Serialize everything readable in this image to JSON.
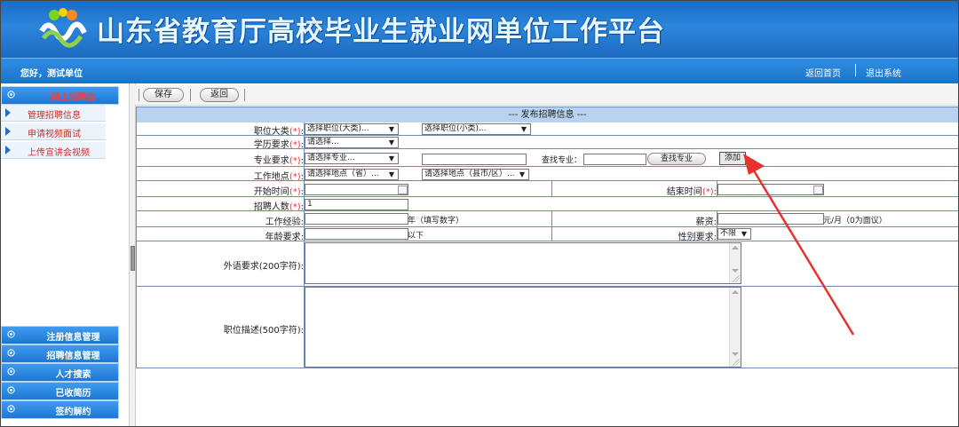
{
  "header": {
    "title": "山东省教育厅高校毕业生就业网单位工作平台",
    "greeting": "您好，测试单位",
    "home_link": "返回首页",
    "logout_link": "退出系统"
  },
  "sidebar": {
    "top_menu": "网上招聘会",
    "sub_items": [
      "管理招聘信息",
      "申请视频面试",
      "上传宣讲会视频"
    ],
    "bottom_menus": [
      "注册信息管理",
      "招聘信息管理",
      "人才搜索",
      "已收简历",
      "签约解约"
    ]
  },
  "toolbar": {
    "save_label": "保存",
    "back_label": "返回"
  },
  "form": {
    "title": "--- 发布招聘信息 ---",
    "required_mark": "(*)",
    "position_category_label": "职位大类",
    "position_category_select": "选择职位(大类)...",
    "position_sub_select": "选择职位(小类)...",
    "education_label": "学历要求",
    "education_select": "请选择...",
    "major_label": "专业要求",
    "major_select": "请选择专业...",
    "find_major_label": "查找专业：",
    "find_major_button": "查找专业",
    "add_button": "添加",
    "location_label": "工作地点",
    "province_select": "请选择地点（省）...",
    "city_select": "请选择地点（县市/区）...",
    "start_time_label": "开始时间",
    "end_time_label": "结束时间",
    "headcount_label": "招聘人数",
    "headcount_value": "1",
    "experience_label": "工作经验:",
    "experience_suffix": "年（填写数字）",
    "salary_label": "薪资:",
    "salary_suffix": "元/月（0为面议）",
    "age_label": "年龄要求:",
    "age_suffix": "以下",
    "gender_label": "性别要求:",
    "gender_select": "不限",
    "language_label": "外语要求(200字符):",
    "description_label": "职位描述(500字符):"
  },
  "annotation": {
    "arrow_color": "#e8312f"
  }
}
